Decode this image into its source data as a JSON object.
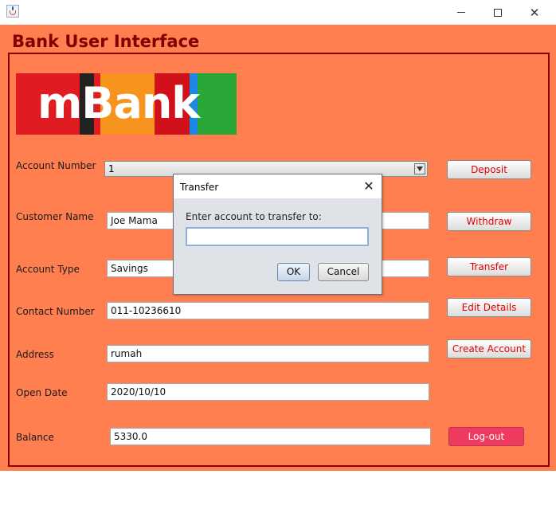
{
  "window": {
    "title_icon": "java-coffee-icon"
  },
  "frame": {
    "title": "Bank User Interface"
  },
  "logo": {
    "text": "mBank",
    "colors": [
      "#e11b22",
      "#f7941d",
      "#d0111b",
      "#1e88e5",
      "#2aa837"
    ]
  },
  "form": {
    "account_number_label": "Account Number",
    "account_number_value": "1",
    "customer_name_label": "Customer Name",
    "customer_name_value": "Joe Mama",
    "account_type_label": "Account Type",
    "account_type_value": "Savings",
    "contact_number_label": "Contact Number",
    "contact_number_value": "011-10236610",
    "address_label": "Address",
    "address_value": "rumah",
    "open_date_label": "Open Date",
    "open_date_value": "2020/10/10",
    "balance_label": "Balance",
    "balance_value": "5330.0"
  },
  "buttons": {
    "deposit": "Deposit",
    "withdraw": "Withdraw",
    "transfer": "Transfer",
    "edit_details": "Edit Details",
    "create_account": "Create Account",
    "logout": "Log-out"
  },
  "dialog": {
    "title": "Transfer",
    "message": "Enter account to transfer to:",
    "input_value": "",
    "ok": "OK",
    "cancel": "Cancel"
  },
  "colors": {
    "frame_bg": "#ff7f50",
    "title": "#800000",
    "button_text": "#e00000",
    "logout_bg": "#ee3a5f"
  }
}
